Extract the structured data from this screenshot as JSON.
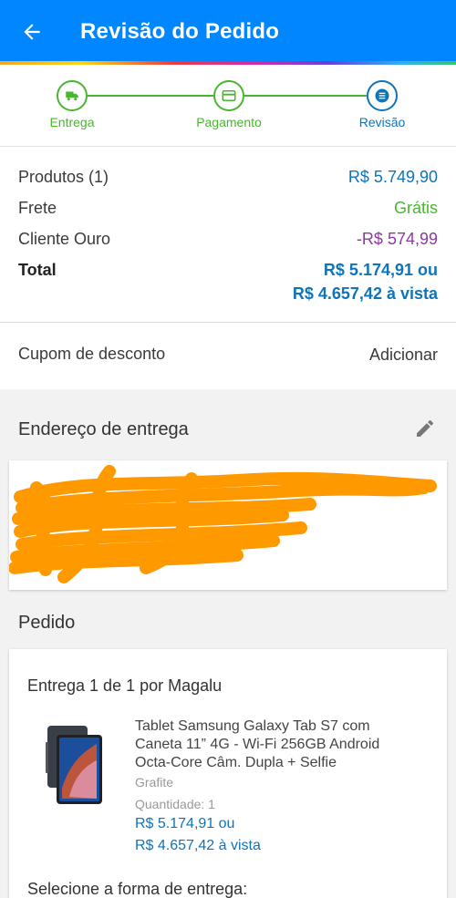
{
  "header": {
    "title": "Revisão do Pedido"
  },
  "steps": [
    {
      "label": "Entrega",
      "icon": "truck-icon"
    },
    {
      "label": "Pagamento",
      "icon": "card-icon"
    },
    {
      "label": "Revisão",
      "icon": "list-icon"
    }
  ],
  "summary": {
    "products_label": "Produtos (1)",
    "products_value": "R$ 5.749,90",
    "shipping_label": "Frete",
    "shipping_value": "Grátis",
    "discount_label": "Cliente Ouro",
    "discount_value": "-R$ 574,99",
    "total_label": "Total",
    "total_value": "R$ 5.174,91 ou",
    "total_cash": "R$ 4.657,42 à vista"
  },
  "coupon": {
    "label": "Cupom de desconto",
    "action": "Adicionar"
  },
  "address": {
    "title": "Endereço de entrega"
  },
  "order": {
    "title": "Pedido",
    "shipment": "Entrega 1 de 1 por Magalu",
    "product": {
      "name": "Tablet Samsung Galaxy Tab S7 com Caneta 11” 4G - Wi-Fi 256GB Android Octa-Core Câm. Dupla + Selfie",
      "color": "Grafite",
      "quantity": "Quantidade:  1",
      "price": "R$ 5.174,91 ou",
      "cash": "R$ 4.657,42 à vista"
    },
    "select_shipping": "Selecione a forma de entrega:"
  },
  "colors": {
    "primary": "#0086ff",
    "accent_blue": "#0f74b9",
    "green": "#4ab52f",
    "purple": "#8b3a9e",
    "redaction": "#ff9900"
  }
}
